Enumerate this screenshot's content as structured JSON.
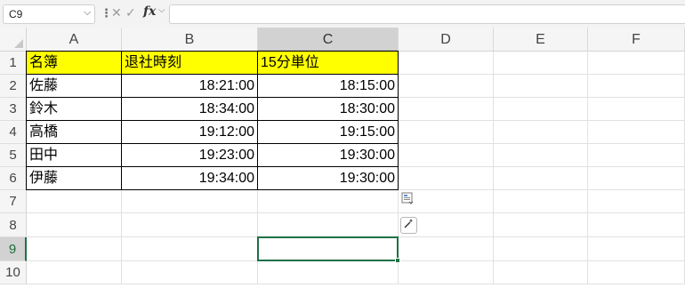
{
  "name_box": {
    "value": "C9"
  },
  "formula_bar": {
    "fx_label": "fx",
    "cancel_glyph": "✕",
    "enter_glyph": "✓",
    "value": ""
  },
  "columns": [
    "A",
    "B",
    "C",
    "D",
    "E",
    "F"
  ],
  "rows": [
    "1",
    "2",
    "3",
    "4",
    "5",
    "6",
    "7",
    "8",
    "9",
    "10"
  ],
  "selected_cell": "C9",
  "accent_color": "#1e7145",
  "header_fill_color": "#ffff00",
  "table": {
    "headers": [
      "名簿",
      "退社時刻",
      "15分単位"
    ],
    "rows": [
      [
        "佐藤",
        "18:21:00",
        "18:15:00"
      ],
      [
        "鈴木",
        "18:34:00",
        "18:30:00"
      ],
      [
        "高橋",
        "19:12:00",
        "19:15:00"
      ],
      [
        "田中",
        "19:23:00",
        "19:30:00"
      ],
      [
        "伊藤",
        "19:34:00",
        "19:30:00"
      ]
    ]
  },
  "floating_buttons": [
    {
      "name": "paste-options-icon"
    },
    {
      "name": "quick-analysis-icon"
    }
  ]
}
